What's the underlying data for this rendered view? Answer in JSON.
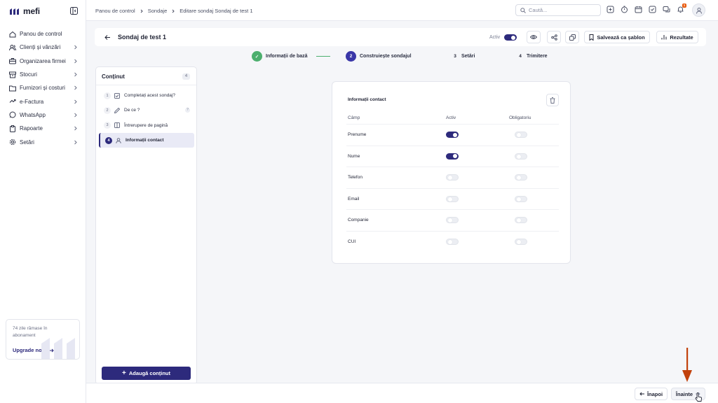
{
  "app": {
    "logo_text": "mefi"
  },
  "sidebar": {
    "items": [
      {
        "label": "Panou de control",
        "icon": "home-icon",
        "has_chevron": false
      },
      {
        "label": "Clienți și vânzări",
        "icon": "users-icon",
        "has_chevron": true
      },
      {
        "label": "Organizarea firmei",
        "icon": "org-icon",
        "has_chevron": true
      },
      {
        "label": "Stocuri",
        "icon": "box-icon",
        "has_chevron": true
      },
      {
        "label": "Furnizori și costuri",
        "icon": "folder-icon",
        "has_chevron": true
      },
      {
        "label": "e-Factura",
        "icon": "efactura-icon",
        "has_chevron": true
      },
      {
        "label": "WhatsApp",
        "icon": "whatsapp-icon",
        "has_chevron": true
      },
      {
        "label": "Rapoarte",
        "icon": "clipboard-icon",
        "has_chevron": true
      },
      {
        "label": "Setări",
        "icon": "gear-icon",
        "has_chevron": true
      }
    ],
    "upgrade": {
      "days_text": "74 zile rămase în abonament",
      "link_label": "Upgrade now"
    }
  },
  "topbar": {
    "breadcrumbs": [
      "Panou de control",
      "Sondaje",
      "Editare sondaj Sondaj de test 1"
    ],
    "search_placeholder": "Caută...",
    "notification_count": "1"
  },
  "header": {
    "title": "Sondaj de test 1",
    "active_label": "Activ",
    "active_on": true,
    "save_template_label": "Salvează ca șablon",
    "results_label": "Rezultate"
  },
  "stepper": {
    "steps": [
      {
        "number": "✓",
        "label": "Informații de bază",
        "state": "done"
      },
      {
        "number": "2",
        "label": "Construiește sondajul",
        "state": "current"
      },
      {
        "number": "3",
        "label": "Setări",
        "state": "todo"
      },
      {
        "number": "4",
        "label": "Trimitere",
        "state": "todo"
      }
    ]
  },
  "content_panel": {
    "title": "Conținut",
    "count": "4",
    "items": [
      {
        "number": "1",
        "label": "Completați acest sondaj?",
        "icon": "checkbox-icon",
        "has_info": false
      },
      {
        "number": "2",
        "label": "De ce ?",
        "icon": "edit-icon",
        "has_info": true
      },
      {
        "number": "3",
        "label": "Întrerupere de pagină",
        "icon": "page-break-icon",
        "has_info": false
      },
      {
        "number": "4",
        "label": "Informații contact",
        "icon": "person-icon",
        "has_info": false,
        "active": true
      }
    ],
    "add_button_label": "Adaugă conținut"
  },
  "contact_card": {
    "title": "Informații contact",
    "columns": {
      "field": "Câmp",
      "active": "Activ",
      "required": "Obligatoriu"
    },
    "rows": [
      {
        "field": "Prenume",
        "active": true,
        "required": false
      },
      {
        "field": "Nume",
        "active": true,
        "required": false
      },
      {
        "field": "Telefon",
        "active": false,
        "required": false
      },
      {
        "field": "Email",
        "active": false,
        "required": false
      },
      {
        "field": "Companie",
        "active": false,
        "required": false
      },
      {
        "field": "CUI",
        "active": false,
        "required": false
      }
    ]
  },
  "footer": {
    "back_label": "Înapoi",
    "next_label": "Înainte"
  },
  "colors": {
    "primary": "#2d2a7c",
    "success": "#4caf6e",
    "annotation_arrow": "#c2410c"
  }
}
